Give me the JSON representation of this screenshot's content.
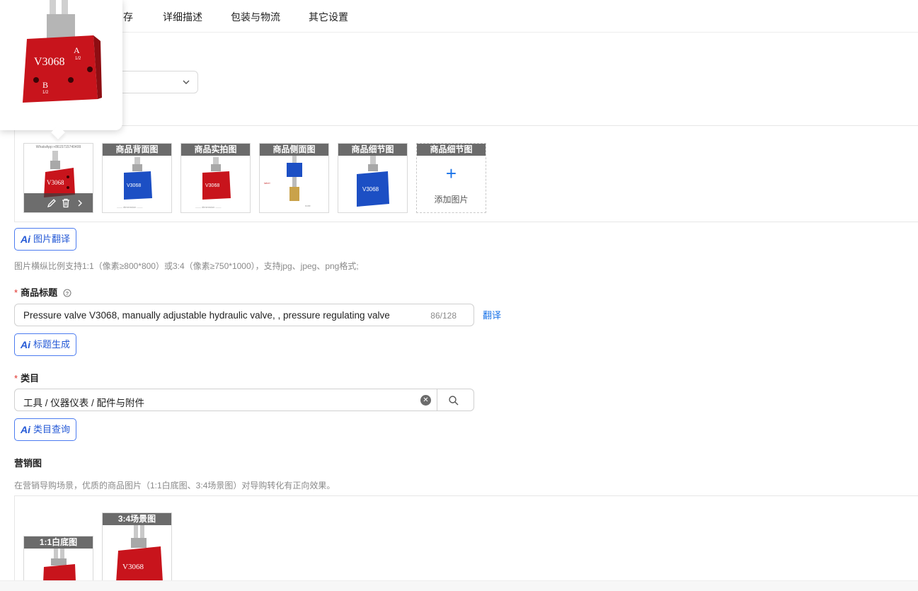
{
  "tabs": [
    "存",
    "详细描述",
    "包装与物流",
    "其它设置"
  ],
  "popup": {
    "model_text": "V3068",
    "port_a": "A",
    "port_a_size": "1/2",
    "port_b": "B",
    "port_b_size": "1/2"
  },
  "images": {
    "thumbs": [
      {
        "caption": "",
        "color": "red",
        "watermark": "WhatsApp:+8615715740499"
      },
      {
        "caption": "商品背面图",
        "color": "blue"
      },
      {
        "caption": "商品实拍图",
        "color": "red"
      },
      {
        "caption": "商品侧面图",
        "color": "blue"
      },
      {
        "caption": "商品细节图",
        "color": "blue"
      }
    ],
    "add_caption": "商品细节图",
    "add_label": "添加图片",
    "plus": "+"
  },
  "ai_translate_label": "图片翻译",
  "image_hint": "图片横纵比例支持1:1（像素≥800*800）或3:4（像素≥750*1000），支持jpg、jpeg、png格式;",
  "title_section": {
    "required": "*",
    "label": "商品标题",
    "value": "Pressure valve V3068, manually adjustable hydraulic valve, , pressure regulating valve",
    "count": "86/128",
    "translate": "翻译",
    "ai_label": "标题生成"
  },
  "category_section": {
    "required": "*",
    "label": "类目",
    "value": "工具 / 仪器仪表 / 配件与附件",
    "ai_label": "类目查询"
  },
  "marketing": {
    "label": "营销图",
    "hint": "在营销导购场景，优质的商品图片（1:1白底图、3:4场景图）对导购转化有正向效果。",
    "thumbs": [
      {
        "caption": "1:1白底图"
      },
      {
        "caption": "3:4场景图"
      }
    ]
  },
  "ai_glyph": "Ai",
  "colors": {
    "accent": "#1a73e8",
    "ai_border": "#4c7cf0",
    "valve_red": "#c8141c",
    "valve_blue": "#1c4fc4",
    "required": "#e0312b"
  }
}
